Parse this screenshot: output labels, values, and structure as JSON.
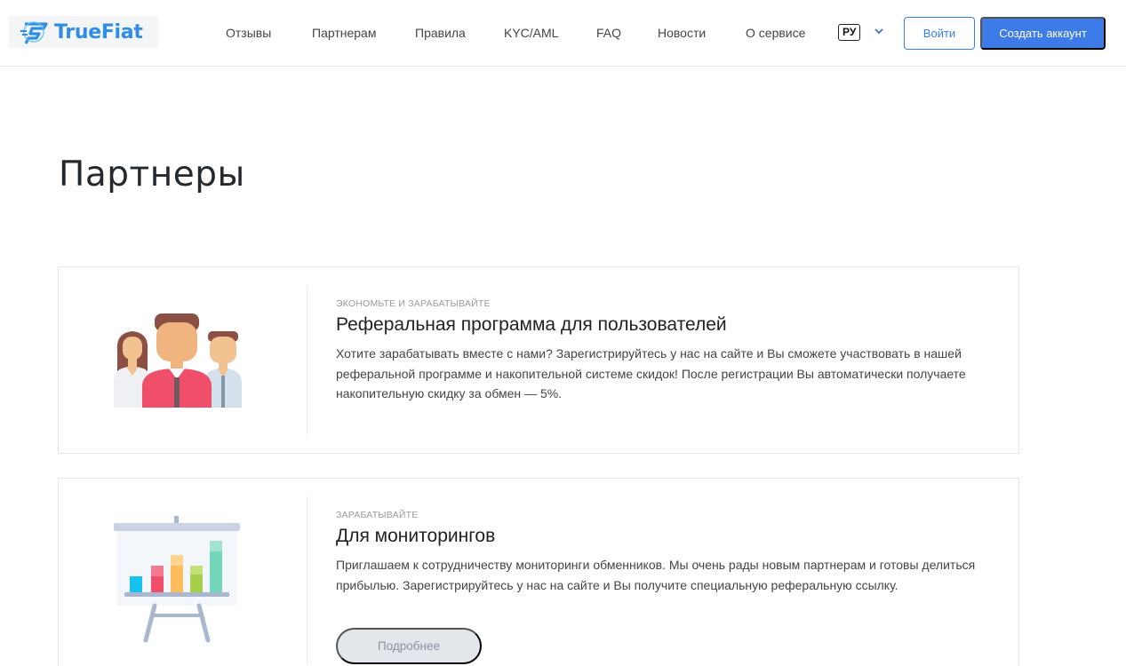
{
  "header": {
    "logo_text": "TrueFiat",
    "nav": [
      "Отзывы",
      "Партнерам",
      "Правила",
      "KYC/AML",
      "FAQ",
      "Новости",
      "О сервисе"
    ],
    "language": "РУ",
    "login_label": "Войти",
    "signup_label": "Создать аккаунт"
  },
  "page": {
    "title": "Партнеры"
  },
  "cards": [
    {
      "kicker": "Экономьте и зарабатывайте",
      "title": "Реферальная программа для пользователей",
      "text": "Хотите зарабатывать вместе с нами? Зарегистрируйтесь у нас на сайте и Вы сможете участвовать в нашей реферальной программе и накопительной системе скидок! После регистрации Вы автоматически получаете накопительную скидку за обмен — 5%.",
      "icon": "people-group-icon"
    },
    {
      "kicker": "Зарабатывайте",
      "title": "Для мониторингов",
      "text": "Приглашаем к сотрудничеству мониторинги обменников. Мы очень рады новым партнерам и готовы делиться прибылью. Зарегистрируйтесь у нас на сайте и Вы получите специальную реферальную ссылку.",
      "button_label": "Подробнее",
      "icon": "chart-board-icon"
    }
  ],
  "colors": {
    "accent": "#3d7ce8",
    "logo": "#2f8de4"
  }
}
